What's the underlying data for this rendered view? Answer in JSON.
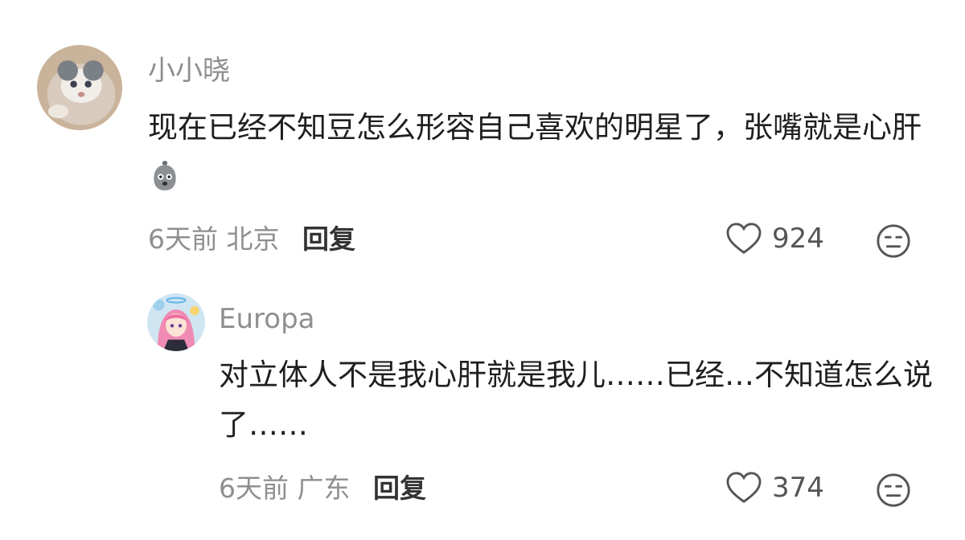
{
  "comments": [
    {
      "username": "小小晓",
      "content": "现在已经不知豆怎么形容自己喜欢的明星了，张嘴就是心肝",
      "emoji_icon": "grey-bag-face-emoji",
      "time": "6天前",
      "location": "北京",
      "reply_label": "回复",
      "like_count": "924"
    },
    {
      "username": "Europa",
      "content": "对立体人不是我心肝就是我儿……已经…不知道怎么说了……",
      "time": "6天前",
      "location": "广东",
      "reply_label": "回复",
      "like_count": "374"
    }
  ]
}
